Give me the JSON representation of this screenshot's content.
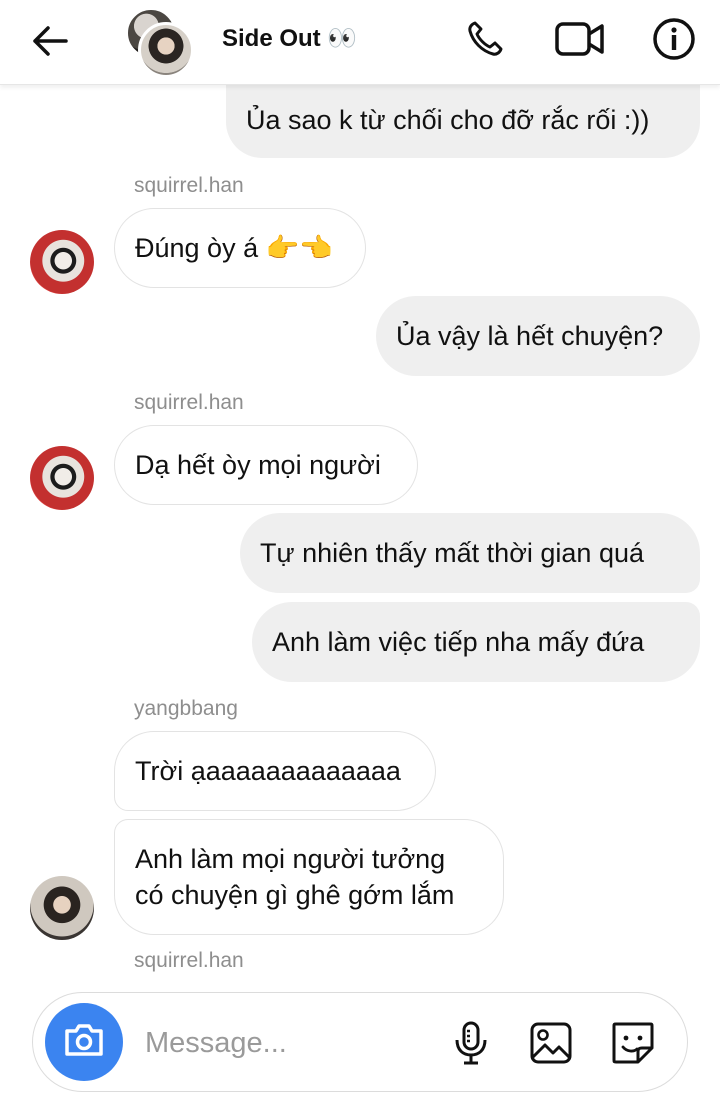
{
  "header": {
    "title": "Side Out 👀",
    "icons": [
      "back-arrow-icon",
      "phone-icon",
      "video-camera-icon",
      "info-icon"
    ]
  },
  "messages": [
    {
      "direction": "outgoing",
      "text": "Ủa sao k từ chối cho đỡ rắc rối :))"
    },
    {
      "sender": "squirrel.han",
      "direction": "incoming",
      "text": "Đúng òy á 👉👈"
    },
    {
      "direction": "outgoing",
      "text": "Ủa vậy là hết chuyện?"
    },
    {
      "sender": "squirrel.han",
      "direction": "incoming",
      "text": "Dạ hết òy mọi người"
    },
    {
      "direction": "outgoing",
      "text": "Tự nhiên thấy mất thời gian quá"
    },
    {
      "direction": "outgoing",
      "text": "Anh làm việc tiếp nha mấy đứa"
    },
    {
      "sender": "yangbbang",
      "direction": "incoming",
      "text": "Trời ạaaaaaaaaaaaaa"
    },
    {
      "direction": "incoming",
      "line1": "Anh làm mọi người tưởng",
      "line2": "có chuyện gì ghê gớm lắm"
    }
  ],
  "typing_sender": "squirrel.han",
  "composer": {
    "placeholder": "Message...",
    "icons": [
      "camera-icon",
      "microphone-icon",
      "gallery-icon",
      "sticker-icon"
    ]
  },
  "colors": {
    "accent": "#3b84f0",
    "outgoing_bubble": "#efefef",
    "muted_text": "#8e8e8e"
  }
}
